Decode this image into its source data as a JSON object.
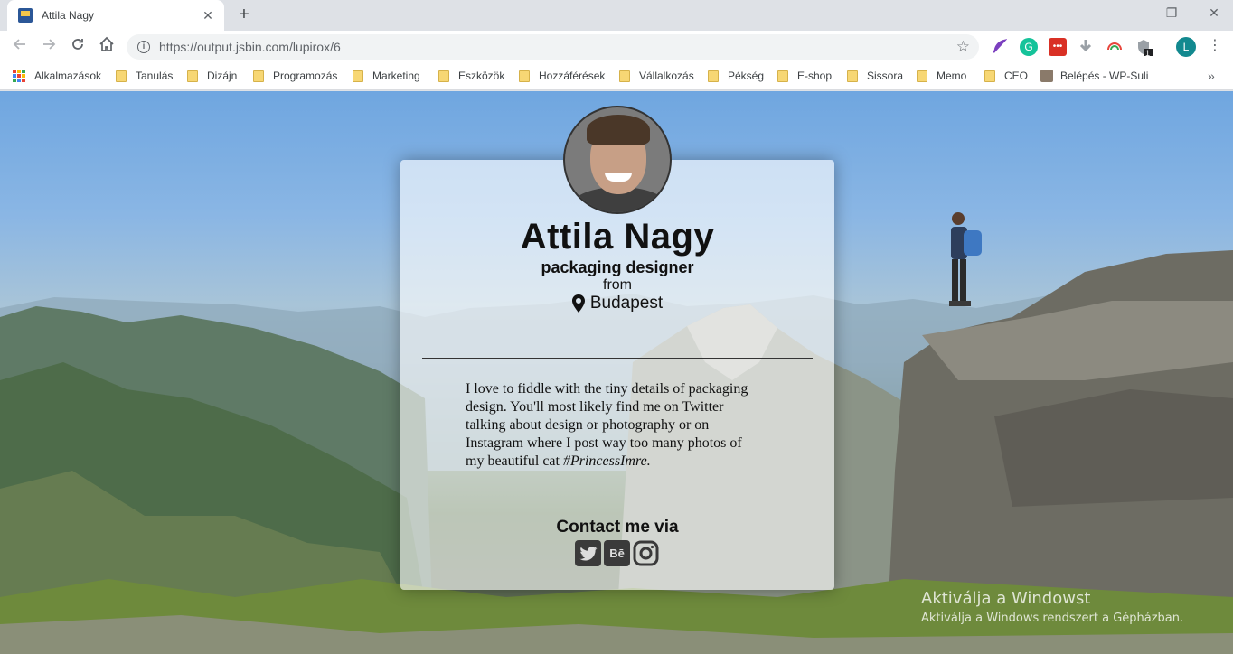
{
  "browser": {
    "tab_title": "Attila Nagy",
    "tab_close": "✕",
    "new_tab": "+",
    "url": "https://output.jsbin.com/lupirox/6",
    "profile_initial": "L",
    "ext_badge": "1",
    "window_controls": {
      "minimize": "—",
      "restore": "❐",
      "close": "✕"
    }
  },
  "bookmarks": {
    "apps": "Alkalmazások",
    "folders": [
      "Tanulás",
      "Dizájn",
      "Programozás",
      "Marketing",
      "Eszközök",
      "Hozzáférések",
      "Vállalkozás",
      "Pékség",
      "E-shop",
      "Sissora",
      "Memo",
      "CEO"
    ],
    "site": "Belépés - WP-Suli",
    "more": "»"
  },
  "profile": {
    "name": "Attila Nagy",
    "role": "packaging designer",
    "from_label": "from",
    "city": "Budapest",
    "bio": "I love to fiddle with the tiny details of packaging design. You'll most likely find me on Twitter talking about design or photography or on Instagram where I post way too many photos of my beautiful cat",
    "bio_tag": "#PrincessImre.",
    "contact_title": "Contact me via",
    "socials": [
      {
        "name": "twitter",
        "icon": "twitter-icon"
      },
      {
        "name": "behance",
        "label": "Bē",
        "icon": "behance-icon"
      },
      {
        "name": "instagram",
        "icon": "instagram-icon"
      }
    ]
  },
  "watermark": {
    "line1": "Aktiválja a Windowst",
    "line2": "Aktiválja a Windows rendszert a Gépházban."
  }
}
